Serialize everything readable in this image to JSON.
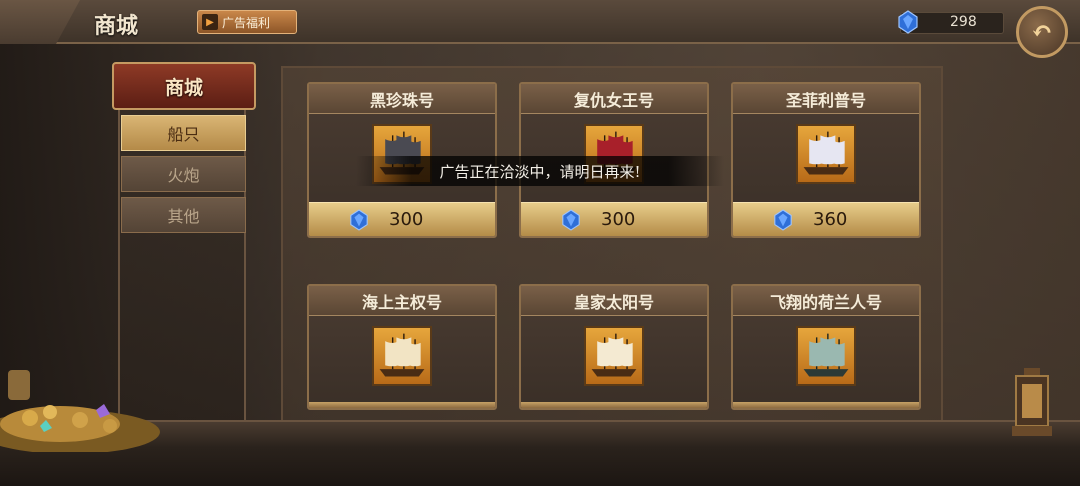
{
  "header": {
    "title": "商城",
    "ad_button_label": "广告福利",
    "currency_value": "298",
    "back_icon": "back-arrow-icon"
  },
  "sidebar": {
    "heading": "商城",
    "items": [
      {
        "label": "船只",
        "active": true
      },
      {
        "label": "火炮",
        "active": false
      },
      {
        "label": "其他",
        "active": false
      }
    ]
  },
  "shop": {
    "cards": [
      {
        "name": "黑珍珠号",
        "price": "300",
        "sail_color": "#4a4a52"
      },
      {
        "name": "复仇女王号",
        "price": "300",
        "sail_color": "#a8202a"
      },
      {
        "name": "圣菲利普号",
        "price": "360",
        "sail_color": "#e6e6f2"
      },
      {
        "name": "海上主权号",
        "price": null,
        "sail_color": "#f2e4c4"
      },
      {
        "name": "皇家太阳号",
        "price": null,
        "sail_color": "#f4ead2"
      },
      {
        "name": "飞翔的荷兰人号",
        "price": null,
        "sail_color": "#9ab8b0"
      }
    ]
  },
  "toast": {
    "message": "广告正在洽淡中，请明日再来!"
  },
  "colors": {
    "gem": "#2f6fd8",
    "accent_gold": "#d9b574",
    "header_red": "#8e3a26"
  }
}
